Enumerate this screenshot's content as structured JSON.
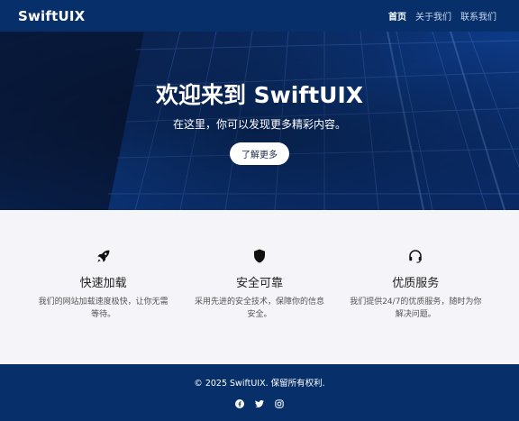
{
  "header": {
    "brand": "SwiftUIX",
    "nav": [
      {
        "label": "首页",
        "active": true
      },
      {
        "label": "关于我们",
        "active": false
      },
      {
        "label": "联系我们",
        "active": false
      }
    ]
  },
  "hero": {
    "title": "欢迎来到 SwiftUIX",
    "subtitle": "在这里，你可以发现更多精彩内容。",
    "button_label": "了解更多"
  },
  "features": [
    {
      "icon": "rocket-icon",
      "title": "快速加载",
      "desc": "我们的网站加载速度极快，让你无需等待。"
    },
    {
      "icon": "shield-icon",
      "title": "安全可靠",
      "desc": "采用先进的安全技术，保障你的信息安全。"
    },
    {
      "icon": "headset-icon",
      "title": "优质服务",
      "desc": "我们提供24/7的优质服务，随时为你解决问题。"
    }
  ],
  "footer": {
    "copyright": "© 2025 SwiftUIX. 保留所有权利.",
    "social": [
      "facebook-icon",
      "twitter-icon",
      "instagram-icon"
    ]
  },
  "colors": {
    "primary": "#07306a",
    "hero_blue": "#0c2f6f",
    "feature_bg": "#f4f4f9"
  }
}
